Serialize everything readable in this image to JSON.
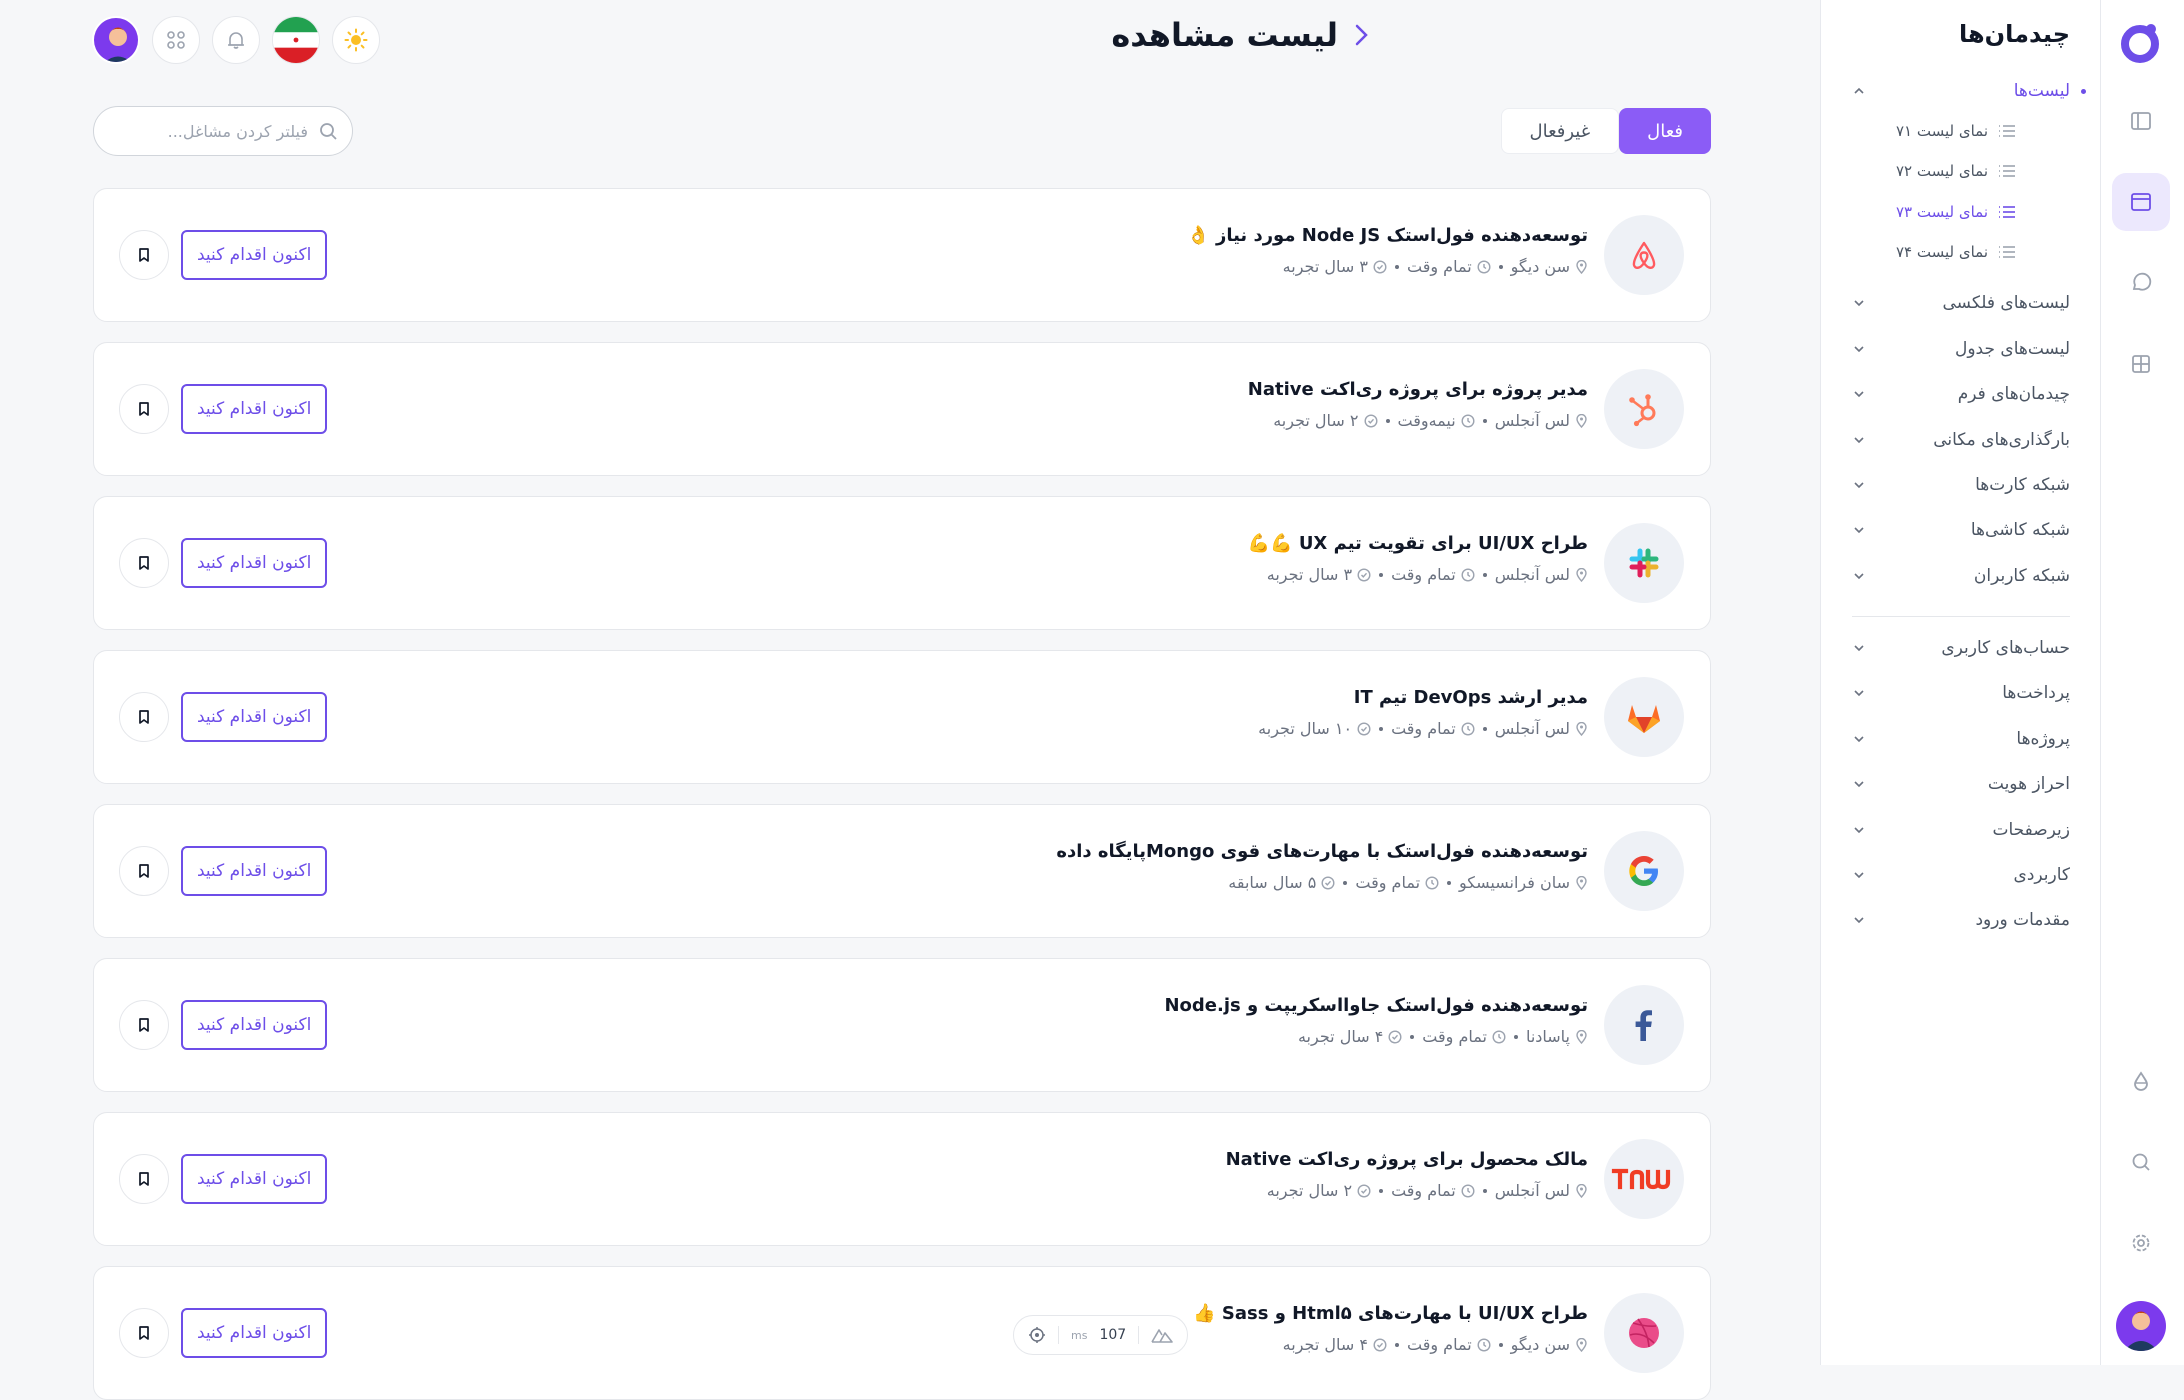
{
  "page": {
    "title": "لیست مشاهده"
  },
  "sidebar": {
    "title": "چیدمان‌ها",
    "lists_label": "لیست‌ها",
    "sub_items": [
      "نمای لیست ۷۱",
      "نمای لیست ۷۲",
      "نمای لیست ۷۳",
      "نمای لیست ۷۴"
    ],
    "groups": [
      "لیست‌های فلکسی",
      "لیست‌های جدول",
      "چیدمان‌های فرم",
      "بارگذاری‌های مکانی",
      "شبکه کارت‌ها",
      "شبکه کاشی‌ها",
      "شبکه کاربران"
    ],
    "groups2": [
      "حساب‌های کاربری",
      "پرداخت‌ها",
      "پروژه‌ها",
      "احراز هویت",
      "زیرصفحات",
      "کاربردی",
      "مقدمات ورود"
    ]
  },
  "tabs": {
    "active": "فعال",
    "inactive": "غیرفعال"
  },
  "search": {
    "placeholder": "فیلتر کردن مشاغل..."
  },
  "apply_label": "اکنون اقدام کنید",
  "jobs": [
    {
      "company": "airbnb-logo",
      "title": "توسعه‌دهنده فول‌استک Node JS مورد نیاز 👌",
      "location": "سن دیگو",
      "type": "تمام وقت",
      "experience": "۳ سال تجربه"
    },
    {
      "company": "hubspot-logo",
      "title": "مدیر پروژه برای پروژه ری‌اکت Native",
      "location": "لس آنجلس",
      "type": "نیمه‌وقت",
      "experience": "۲ سال تجربه"
    },
    {
      "company": "slack-logo",
      "title": "طراح UI/UX برای تقویت تیم UX 💪💪",
      "location": "لس آنجلس",
      "type": "تمام وقت",
      "experience": "۳ سال تجربه"
    },
    {
      "company": "gitlab-logo",
      "title": "مدیر ارشد DevOps تیم IT",
      "location": "لس آنجلس",
      "type": "تمام وقت",
      "experience": "۱۰ سال تجربه"
    },
    {
      "company": "google-logo",
      "title": "توسعه‌دهنده فول‌استک با مهارت‌های قوی Mongoپایگاه داده",
      "location": "سان فرانسیسکو",
      "type": "تمام وقت",
      "experience": "۵ سال سابقه"
    },
    {
      "company": "facebook-logo",
      "title": "توسعه‌دهنده فول‌استک جاوااسکریپت و Node.js",
      "location": "پاسادنا",
      "type": "تمام وقت",
      "experience": "۴ سال تجربه"
    },
    {
      "company": "tnw-logo",
      "title": "مالک محصول برای پروژه ری‌اکت Native",
      "location": "لس آنجلس",
      "type": "تمام وقت",
      "experience": "۲ سال تجربه"
    },
    {
      "company": "dribbble-logo",
      "title": "طراح UI/UX با مهارت‌های Html۵ و Sass 👍",
      "location": "سن دیگو",
      "type": "تمام وقت",
      "experience": "۴ سال تجربه"
    }
  ],
  "perf": {
    "value": "107",
    "unit": "ms"
  },
  "colors": {
    "accent": "#6d4ee8",
    "tab_active": "#8b5cf6"
  }
}
